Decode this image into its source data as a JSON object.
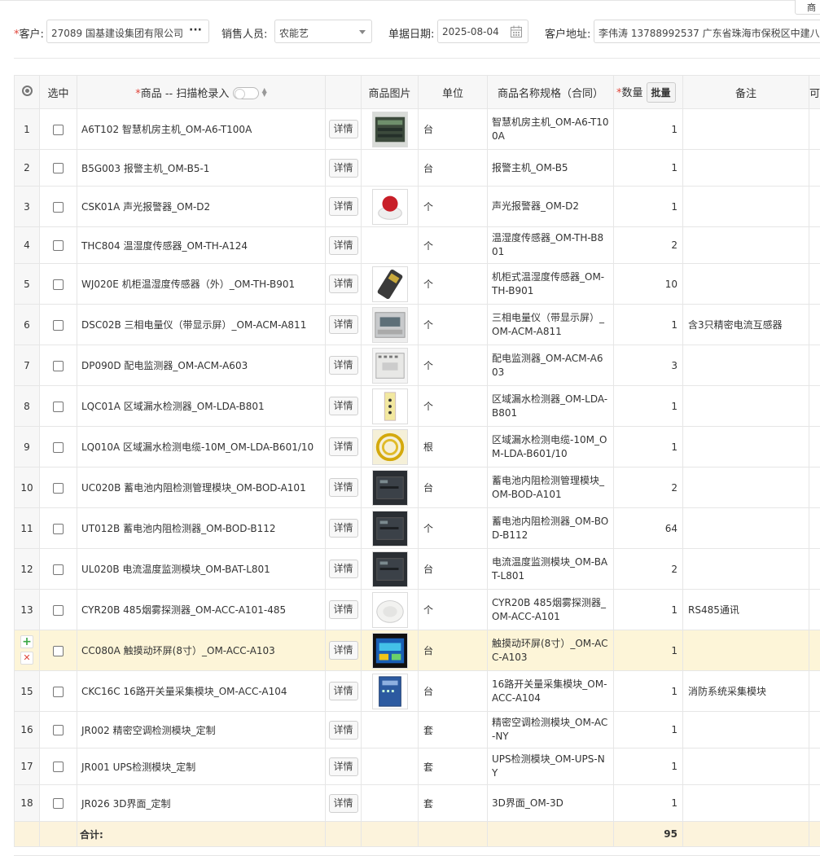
{
  "top_corner_label": "商",
  "form": {
    "customer_label": "客户:",
    "customer_value": "27089 国基建设集团有限公司",
    "salesperson_label": "销售人员:",
    "salesperson_value": "农能艺",
    "date_label": "单据日期:",
    "date_value": "2025-08-04",
    "address_label": "客户地址:",
    "address_value": "李伟涛 13788992537    广东省珠海市保税区中建八"
  },
  "columns": {
    "select": "选中",
    "product": "商品 -- 扫描枪录入",
    "image": "商品图片",
    "unit": "单位",
    "spec": "商品名称规格（合同）",
    "qty": "数量",
    "batch": "批量",
    "note": "备注",
    "extra": "可"
  },
  "detail_label": "详情",
  "rows": [
    {
      "idx": "1",
      "name": "A6T102 智慧机房主机_OM-A6-T100A",
      "unit": "台",
      "spec": "智慧机房主机_OM-A6-T100A",
      "qty": "1",
      "note": "",
      "img": "server"
    },
    {
      "idx": "2",
      "name": "B5G003 报警主机_OM-B5-1",
      "unit": "台",
      "spec": "报警主机_OM-B5",
      "qty": "1",
      "note": "",
      "img": ""
    },
    {
      "idx": "3",
      "name": "CSK01A 声光报警器_OM-D2",
      "unit": "个",
      "spec": "声光报警器_OM-D2",
      "qty": "1",
      "note": "",
      "img": "alarm"
    },
    {
      "idx": "4",
      "name": "THC804 温湿度传感器_OM-TH-A124",
      "unit": "个",
      "spec": "温湿度传感器_OM-TH-B801",
      "qty": "2",
      "note": "",
      "img": ""
    },
    {
      "idx": "5",
      "name": "WJ020E 机柜温湿度传感器（外）_OM-TH-B901",
      "unit": "个",
      "spec": "机柜式温湿度传感器_OM-TH-B901",
      "qty": "10",
      "note": "",
      "img": "sensor"
    },
    {
      "idx": "6",
      "name": "DSC02B 三相电量仪（带显示屏）_OM-ACM-A811",
      "unit": "个",
      "spec": "三相电量仪（带显示屏）_OM-ACM-A811",
      "qty": "1",
      "note": "含3只精密电流互感器",
      "img": "meter"
    },
    {
      "idx": "7",
      "name": "DP090D 配电监测器_OM-ACM-A603",
      "unit": "个",
      "spec": "配电监测器_OM-ACM-A603",
      "qty": "3",
      "note": "",
      "img": "module"
    },
    {
      "idx": "8",
      "name": "LQC01A 区域漏水检测器_OM-LDA-B801",
      "unit": "个",
      "spec": "区域漏水检测器_OM-LDA-B801",
      "qty": "1",
      "note": "",
      "img": "leak"
    },
    {
      "idx": "9",
      "name": "LQ010A 区域漏水检测电缆-10M_OM-LDA-B601/10",
      "unit": "根",
      "spec": "区域漏水检测电缆-10M_OM-LDA-B601/10",
      "qty": "1",
      "note": "",
      "img": "cable"
    },
    {
      "idx": "10",
      "name": "UC020B 蓄电池内阻检测管理模块_OM-BOD-A101",
      "unit": "台",
      "spec": "蓄电池内阻检测管理模块_OM-BOD-A101",
      "qty": "2",
      "note": "",
      "img": "dark"
    },
    {
      "idx": "11",
      "name": "UT012B 蓄电池内阻检测器_OM-BOD-B112",
      "unit": "个",
      "spec": "蓄电池内阻检测器_OM-BOD-B112",
      "qty": "64",
      "note": "",
      "img": "dark"
    },
    {
      "idx": "12",
      "name": "UL020B 电流温度监测模块_OM-BAT-L801",
      "unit": "台",
      "spec": "电流温度监测模块_OM-BAT-L801",
      "qty": "2",
      "note": "",
      "img": "dark"
    },
    {
      "idx": "13",
      "name": "CYR20B 485烟雾探测器_OM-ACC-A101-485",
      "unit": "个",
      "spec": "CYR20B 485烟雾探测器_OM-ACC-A101",
      "qty": "1",
      "note": "RS485通讯",
      "img": "smoke"
    },
    {
      "idx": "",
      "name": "CC080A 触摸动环屏(8寸）_OM-ACC-A103",
      "unit": "台",
      "spec": "触摸动环屏(8寸）_OM-ACC-A103",
      "qty": "1",
      "note": "",
      "img": "screen",
      "highlight": true
    },
    {
      "idx": "15",
      "name": "CKC16C 16路开关量采集模块_OM-ACC-A104",
      "unit": "台",
      "spec": "16路开关量采集模块_OM-ACC-A104",
      "qty": "1",
      "note": "消防系统采集模块",
      "img": "blue"
    },
    {
      "idx": "16",
      "name": "JR002 精密空调检测模块_定制",
      "unit": "套",
      "spec": "精密空调检测模块_OM-AC-NY",
      "qty": "1",
      "note": "",
      "img": ""
    },
    {
      "idx": "17",
      "name": "JR001 UPS检测模块_定制",
      "unit": "套",
      "spec": "UPS检测模块_OM-UPS-NY",
      "qty": "1",
      "note": "",
      "img": ""
    },
    {
      "idx": "18",
      "name": "JR026 3D界面_定制",
      "unit": "套",
      "spec": "3D界面_OM-3D",
      "qty": "1",
      "note": "",
      "img": ""
    }
  ],
  "total": {
    "label": "合计:",
    "qty": "95"
  }
}
